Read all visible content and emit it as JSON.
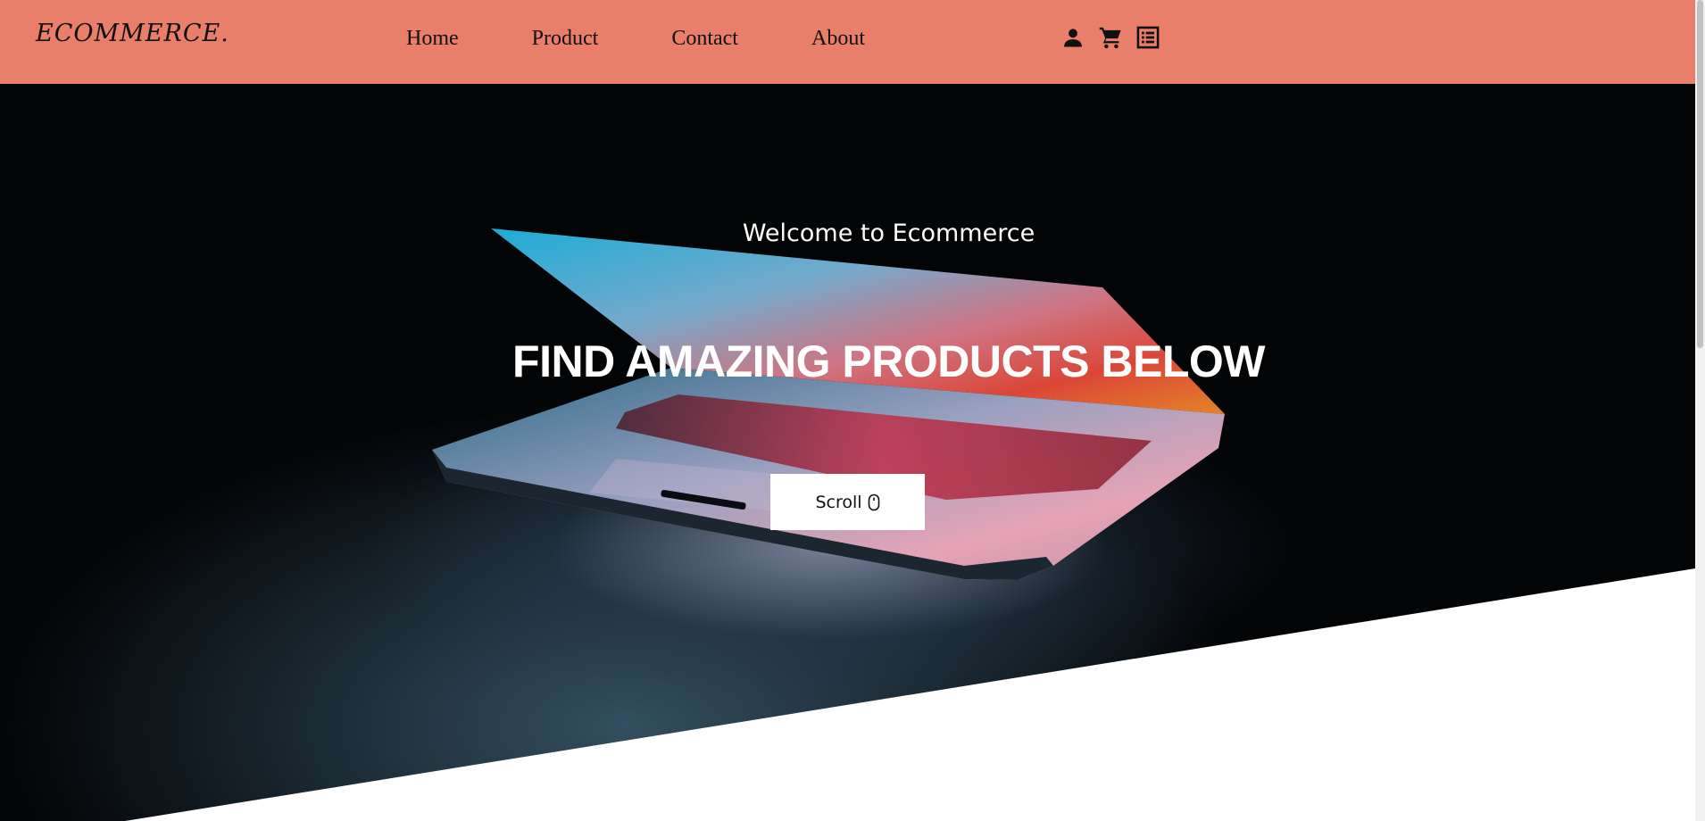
{
  "navbar": {
    "logo": "ECOMMERCE.",
    "links": [
      {
        "label": "Home"
      },
      {
        "label": "Product"
      },
      {
        "label": "Contact"
      },
      {
        "label": "About"
      }
    ],
    "icons": [
      "user-icon",
      "cart-icon",
      "orders-list-icon"
    ],
    "background_color": "#e97e6a"
  },
  "hero": {
    "welcome": "Welcome to Ecommerce",
    "headline": "FIND AMAZING PRODUCTS BELOW",
    "scroll_button_label": "Scroll",
    "scroll_button_icon": "mouse-icon"
  }
}
